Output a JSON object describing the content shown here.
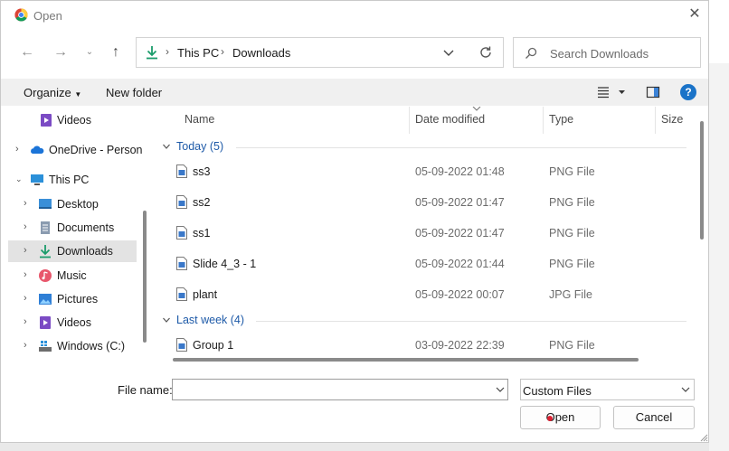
{
  "window": {
    "title": "Open"
  },
  "address": {
    "crumbs": [
      "This PC",
      "Downloads"
    ]
  },
  "search": {
    "placeholder": "Search Downloads"
  },
  "toolbar": {
    "organize": "Organize",
    "new_folder": "New folder"
  },
  "nav": {
    "items": [
      {
        "label": "Videos",
        "icon": "videos-icon"
      },
      {
        "label": "OneDrive - Person",
        "icon": "onedrive-icon"
      },
      {
        "label": "This PC",
        "icon": "pc-icon"
      },
      {
        "label": "Desktop",
        "icon": "desktop-icon"
      },
      {
        "label": "Documents",
        "icon": "documents-icon"
      },
      {
        "label": "Downloads",
        "icon": "downloads-icon"
      },
      {
        "label": "Music",
        "icon": "music-icon"
      },
      {
        "label": "Pictures",
        "icon": "pictures-icon"
      },
      {
        "label": "Videos",
        "icon": "videos-icon"
      },
      {
        "label": "Windows (C:)",
        "icon": "drive-icon"
      }
    ]
  },
  "columns": {
    "name": "Name",
    "date": "Date modified",
    "type": "Type",
    "size": "Size"
  },
  "groups": [
    {
      "label": "Today (5)"
    },
    {
      "label": "Last week (4)"
    }
  ],
  "files": [
    {
      "name": "ss3",
      "date": "05-09-2022 01:48",
      "type": "PNG File"
    },
    {
      "name": "ss2",
      "date": "05-09-2022 01:47",
      "type": "PNG File"
    },
    {
      "name": "ss1",
      "date": "05-09-2022 01:47",
      "type": "PNG File"
    },
    {
      "name": "Slide 4_3 - 1",
      "date": "05-09-2022 01:44",
      "type": "PNG File"
    },
    {
      "name": "plant",
      "date": "05-09-2022 00:07",
      "type": "JPG File"
    },
    {
      "name": "Group 1",
      "date": "03-09-2022 22:39",
      "type": "PNG File"
    }
  ],
  "footer": {
    "file_name_label": "File name:",
    "file_name_value": "",
    "filter": "Custom Files",
    "open": "Open",
    "cancel": "Cancel"
  },
  "colors": {
    "accent": "#1e5aa8",
    "help": "#1a73c8",
    "selected": "#e3e3e3"
  }
}
